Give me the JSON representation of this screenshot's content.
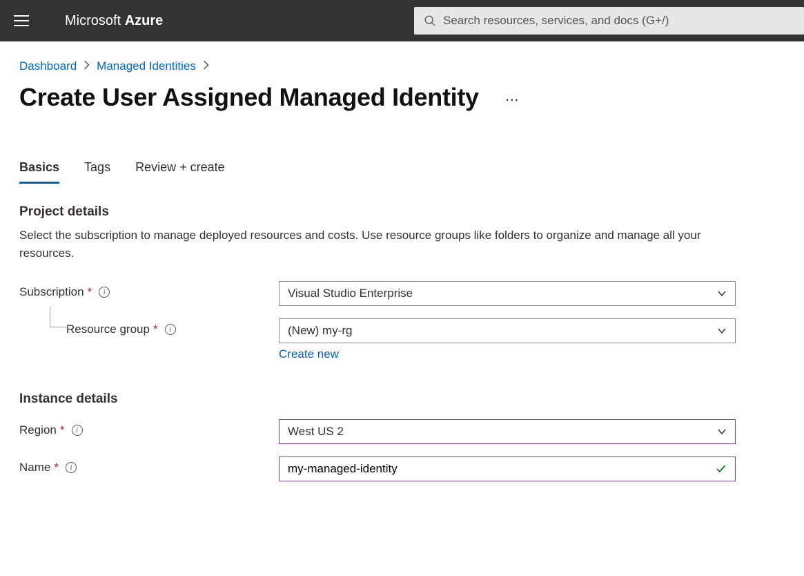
{
  "header": {
    "brand_html_prefix": "Microsoft ",
    "brand_html_suffix": "Azure",
    "search_placeholder": "Search resources, services, and docs (G+/)"
  },
  "breadcrumb": {
    "items": [
      "Dashboard",
      "Managed Identities"
    ]
  },
  "page": {
    "title": "Create User Assigned Managed Identity"
  },
  "tabs": [
    {
      "label": "Basics",
      "active": true
    },
    {
      "label": "Tags",
      "active": false
    },
    {
      "label": "Review + create",
      "active": false
    }
  ],
  "project_details": {
    "heading": "Project details",
    "description": "Select the subscription to manage deployed resources and costs. Use resource groups like folders to organize and manage all your resources.",
    "subscription_label": "Subscription",
    "subscription_value": "Visual Studio Enterprise",
    "resource_group_label": "Resource group",
    "resource_group_value": "(New) my-rg",
    "create_new_label": "Create new"
  },
  "instance_details": {
    "heading": "Instance details",
    "region_label": "Region",
    "region_value": "West US 2",
    "name_label": "Name",
    "name_value": "my-managed-identity"
  }
}
